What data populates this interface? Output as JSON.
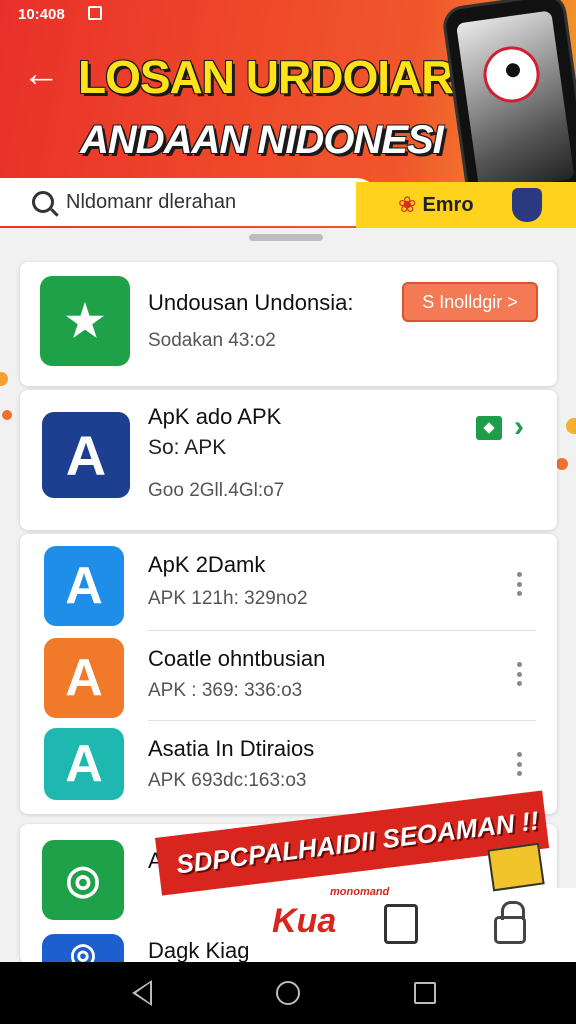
{
  "status_bar": {
    "time": "10:408",
    "icons": [
      "wifi-icon",
      "signal-icon",
      "battery-icon"
    ]
  },
  "header": {
    "title_line1": "LOSAN URDOIAR",
    "title_line2": "ANDAAN NIDONESI",
    "search_placeholder": "Nldomanr dlerahan",
    "promo_label": "Emro",
    "colors": {
      "background": "#ef4a2a",
      "title": "#ffe21a",
      "promo": "#ffd21e"
    }
  },
  "featured": [
    {
      "name": "Undousan Undonsia:",
      "meta": "Sodakan 43:o2",
      "icon": "green-star-icon",
      "button_label": "S Inolldgir >"
    },
    {
      "name": "ApK ado APK",
      "meta1": "So: APK",
      "meta2": "Goo 2Gll.4Gl:o7",
      "icon": "blue-a-icon"
    }
  ],
  "list": [
    {
      "name": "ApK 2Damk",
      "meta": "APK 121h: 329no2",
      "icon": "appstore-a-icon"
    },
    {
      "name": "Coatle ohntbusian",
      "meta": "APK : 369: 336:o3",
      "icon": "orange-a-icon"
    },
    {
      "name": "Asatia In Dtiraios",
      "meta": "APK 693dc:163:o3",
      "icon": "teal-a-icon"
    }
  ],
  "bottom_list": [
    {
      "name": "Aulio",
      "icon": "green-circle-icon"
    },
    {
      "name": "Dagk Kiag",
      "icon": "blue-circle-icon"
    }
  ],
  "banner": {
    "text": "SDPCPALHAIDII SEOAMAN !!",
    "logo": "Kua",
    "logo_sub": "monomand"
  }
}
